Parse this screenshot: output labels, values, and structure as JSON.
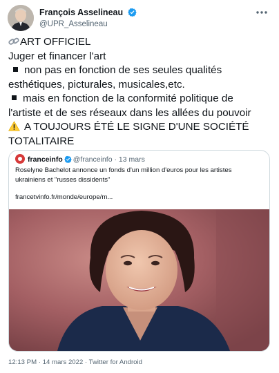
{
  "author": {
    "name": "François Asselineau",
    "handle": "@UPR_Asselineau"
  },
  "body": {
    "line1": "ART OFFICIEL",
    "line2": "Juger et financer l'art",
    "line3": "non pas en fonction de ses seules qualités",
    "line4": "esthétiques, picturales, musicales,etc.",
    "line5": "mais en fonction de la conformité politique de",
    "line6": "l'artiste et de ses réseaux dans les allées du pouvoir",
    "line7": "A TOUJOURS ÉTÉ LE SIGNE D'UNE SOCIÉTÉ",
    "line8": "TOTALITAIRE"
  },
  "quoted": {
    "name": "franceinfo",
    "handle": "@franceinfo",
    "separator": "·",
    "date": "13 mars",
    "text_line1": "Roselyne Bachelot annonce un fonds d'un million d'euros pour les artistes",
    "text_line2": "ukrainiens et \"russes dissidents\"",
    "link": "francetvinfo.fr/monde/europe/m..."
  },
  "footer": {
    "time": "12:13 PM",
    "date": "14 mars 2022",
    "source": "Twitter for Android",
    "separator": "·"
  },
  "icons": {
    "more": "more-options-icon",
    "verified": "verified-badge-icon",
    "link": "link-icon",
    "warning": "warning-icon",
    "bullet": "black-square-bullet"
  },
  "colors": {
    "verified": "#1d9bf0",
    "secondary_text": "#536471",
    "border": "#cfd9de",
    "franceinfo": "#d63a3a"
  }
}
